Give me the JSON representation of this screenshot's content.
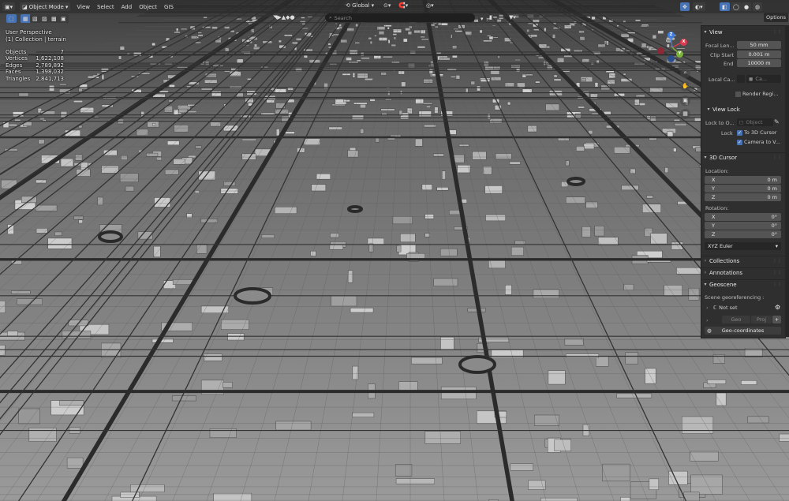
{
  "toolbar": {
    "mode_label": "Object Mode",
    "menus": [
      "View",
      "Select",
      "Add",
      "Object",
      "GIS"
    ],
    "transform_orientation": "Global",
    "options_label": "Options"
  },
  "header2": {
    "search_placeholder": "Search"
  },
  "overlay": {
    "view_name": "User Perspective",
    "collection_path": "(1) Collection | terrain",
    "stats": [
      {
        "label": "Objects",
        "value": "7"
      },
      {
        "label": "Vertices",
        "value": "1,622,108"
      },
      {
        "label": "Edges",
        "value": "2,789,892"
      },
      {
        "label": "Faces",
        "value": "1,398,032"
      },
      {
        "label": "Triangles",
        "value": "2,841,713"
      }
    ]
  },
  "gizmo": {
    "axes": [
      "X",
      "Y",
      "Z"
    ]
  },
  "panel": {
    "view_section": "View",
    "focal_length_label": "Focal Len...",
    "focal_length_value": "50 mm",
    "clip_start_label": "Clip Start",
    "clip_start_value": "0.001 m",
    "clip_end_label": "End",
    "clip_end_value": "10000 m",
    "local_camera_label": "Local Ca...",
    "local_camera_value": "Ca...",
    "render_region_label": "Render Regi...",
    "view_lock_section": "View Lock",
    "lock_to_object_label": "Lock to O...",
    "lock_to_object_placeholder": "Object",
    "lock_label": "Lock",
    "to_3d_cursor_label": "To 3D Cursor",
    "camera_to_view_label": "Camera to V...",
    "cursor_section": "3D Cursor",
    "location_label": "Location:",
    "location": [
      {
        "axis": "X",
        "value": "0 m"
      },
      {
        "axis": "Y",
        "value": "0 m"
      },
      {
        "axis": "Z",
        "value": "0 m"
      }
    ],
    "rotation_label": "Rotation:",
    "rotation": [
      {
        "axis": "X",
        "value": "0°"
      },
      {
        "axis": "Y",
        "value": "0°"
      },
      {
        "axis": "Z",
        "value": "0°"
      }
    ],
    "rotation_mode": "XYZ Euler",
    "collections_section": "Collections",
    "annotations_section": "Annotations",
    "geoscene_section": "Geoscene",
    "scene_georef_label": "Scene georeferencing :",
    "crs_value": "Not set",
    "geo_label": "Geo",
    "proj_label": "Proj",
    "geocoords_label": "Geo-coordinates"
  },
  "colors": {
    "accent": "#4772b3",
    "axis_x": "#d93c4e",
    "axis_y": "#7ab43a",
    "axis_z": "#3f7ce0"
  }
}
